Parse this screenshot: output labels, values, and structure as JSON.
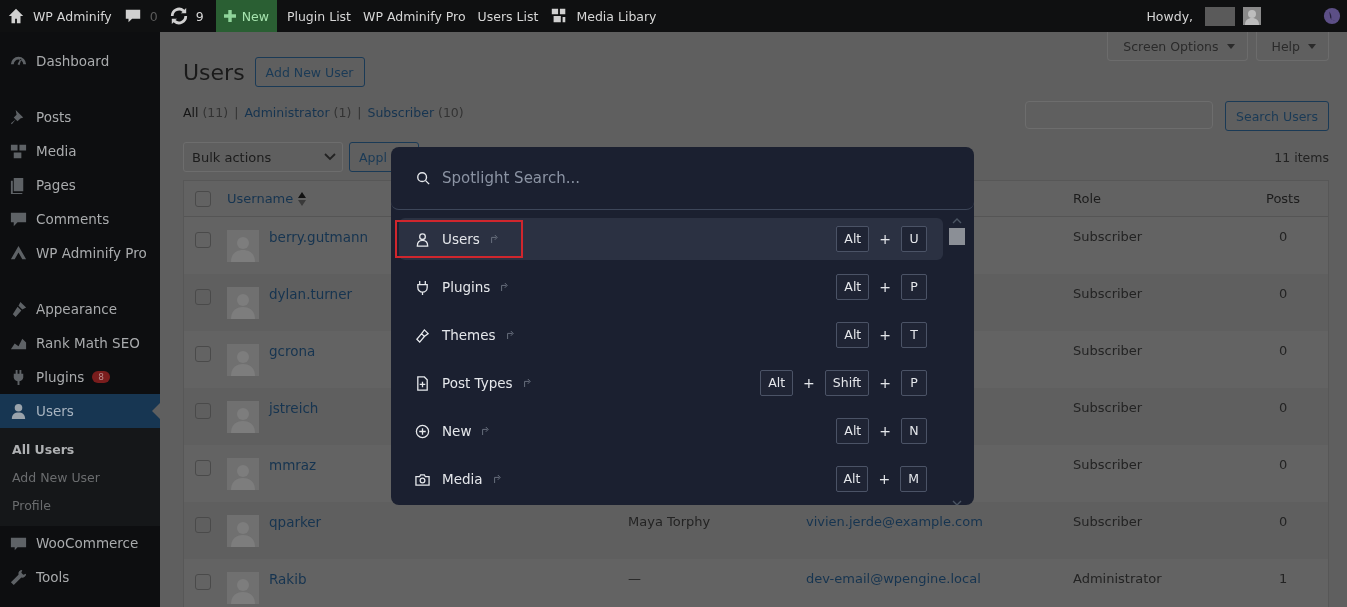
{
  "admin_bar": {
    "site": "WP Adminify",
    "comments": "0",
    "updates": "9",
    "new": "New",
    "links": [
      {
        "label": "Plugin List"
      },
      {
        "label": "WP Adminify Pro"
      },
      {
        "label": "Users List"
      },
      {
        "label": "Media Libary",
        "icon": true
      }
    ],
    "greeting": "Howdy,"
  },
  "sidebar": {
    "sections": [
      {
        "items": [
          {
            "label": "Dashboard",
            "selected": false
          }
        ]
      },
      {
        "items": [
          {
            "label": "Posts",
            "selected": false
          },
          {
            "label": "Media",
            "selected": false
          },
          {
            "label": "Pages",
            "selected": false
          },
          {
            "label": "Comments",
            "selected": false
          },
          {
            "label": "WP Adminify Pro",
            "selected": false
          }
        ]
      },
      {
        "items": [
          {
            "label": "Appearance",
            "selected": false
          },
          {
            "label": "Rank Math SEO",
            "selected": false
          },
          {
            "label": "Plugins",
            "selected": false,
            "badge": "8"
          },
          {
            "label": "Users",
            "selected": true,
            "submenu": [
              {
                "label": "All Users",
                "selected": true
              },
              {
                "label": "Add New User",
                "selected": false
              },
              {
                "label": "Profile",
                "selected": false
              }
            ]
          },
          {
            "label": "WooCommerce",
            "selected": false
          },
          {
            "label": "Tools",
            "selected": false
          }
        ]
      }
    ]
  },
  "header_buttons": [
    "Screen Options",
    "Help"
  ],
  "page": {
    "title": "Users",
    "add_button": "Add New User",
    "filters": [
      {
        "label": "All",
        "count": "(11)",
        "selected": true
      },
      {
        "separator": "|",
        "label": "Administrator",
        "count": "(1)",
        "selected": false
      },
      {
        "separator": "|",
        "label": "Subscriber",
        "count": "(10)",
        "selected": false
      }
    ],
    "search_button": "Search Users",
    "bulk_actions": "Bulk actions",
    "apply": "Appl",
    "item_count": "11 items"
  },
  "table": {
    "select_all_checked": false,
    "columns": [
      {
        "label": "Username",
        "sorted": true
      },
      {
        "label": "Role"
      },
      {
        "label": "Posts"
      }
    ],
    "rows": [
      {
        "username": "berry.gutmann",
        "role": "Subscriber",
        "posts": "0",
        "checked": false
      },
      {
        "username": "dylan.turner",
        "role": "Subscriber",
        "posts": "0",
        "checked": false
      },
      {
        "username": "gcrona",
        "role": "Subscriber",
        "posts": "0",
        "checked": false
      },
      {
        "username": "jstreich",
        "role": "Subscriber",
        "posts": "0",
        "checked": false
      },
      {
        "username": "mmraz",
        "role": "Subscriber",
        "posts": "0",
        "checked": false
      },
      {
        "username": "qparker",
        "name": "Maya Torphy",
        "email": "vivien.jerde@example.com",
        "role": "Subscriber",
        "posts": "0",
        "checked": false
      },
      {
        "username": "Rakib",
        "name": "—",
        "email": "dev-email@wpengine.local",
        "role": "Administrator",
        "posts": "1",
        "checked": false
      }
    ]
  },
  "spotlight": {
    "placeholder": "Spotlight Search...",
    "items": [
      {
        "label": "Users",
        "selected": true,
        "outlined": true,
        "shortcut": [
          "Alt",
          "+",
          "U"
        ]
      },
      {
        "label": "Plugins",
        "selected": false,
        "outlined": false,
        "shortcut": [
          "Alt",
          "+",
          "P"
        ]
      },
      {
        "label": "Themes",
        "selected": false,
        "outlined": false,
        "shortcut": [
          "Alt",
          "+",
          "T"
        ]
      },
      {
        "label": "Post Types",
        "selected": false,
        "outlined": false,
        "shortcut": [
          "Alt",
          "+",
          "Shift",
          "+",
          "P"
        ]
      },
      {
        "label": "New",
        "selected": false,
        "outlined": false,
        "shortcut": [
          "Alt",
          "+",
          "N"
        ]
      },
      {
        "label": "Media",
        "selected": false,
        "outlined": false,
        "shortcut": [
          "Alt",
          "+",
          "M"
        ]
      }
    ]
  }
}
